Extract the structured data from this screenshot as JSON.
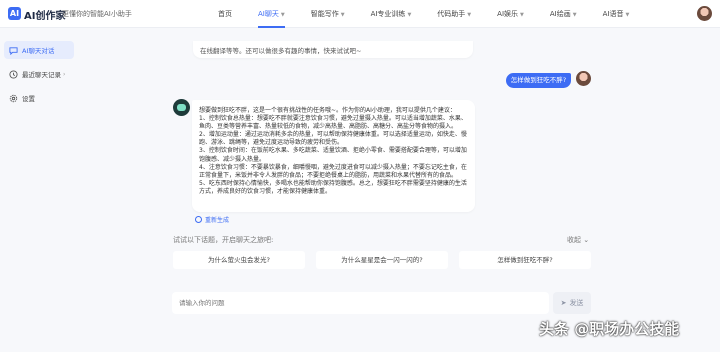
{
  "header": {
    "logo_icon": "AI",
    "logo_text": "AI创作家",
    "slogan": "更懂你的智能AI小助手",
    "nav": [
      {
        "label": "首页",
        "has_chevron": false,
        "active": false
      },
      {
        "label": "AI聊天",
        "has_chevron": true,
        "active": true
      },
      {
        "label": "智能写作",
        "has_chevron": true,
        "active": false
      },
      {
        "label": "AI专业训练",
        "has_chevron": true,
        "active": false
      },
      {
        "label": "代码助手",
        "has_chevron": true,
        "active": false
      },
      {
        "label": "AI娱乐",
        "has_chevron": true,
        "active": false
      },
      {
        "label": "AI绘画",
        "has_chevron": true,
        "active": false
      },
      {
        "label": "AI语音",
        "has_chevron": true,
        "active": false
      }
    ]
  },
  "sidebar": {
    "items": [
      {
        "label": "AI聊天对话",
        "icon": "chat-bubble-icon",
        "active": true
      },
      {
        "label": "最近聊天记录",
        "icon": "clock-icon",
        "active": false,
        "chevron": "›"
      },
      {
        "label": "设置",
        "icon": "gear-icon",
        "active": false
      }
    ]
  },
  "chat": {
    "top_bubble": "在线翻译等等。还可以做很多有趣的事情，快来试试吧~",
    "user_message": "怎样做到狂吃不胖?",
    "bot_reply": [
      "想要做到狂吃不胖，这是一个很有挑战性的任务哦~。作为你的AI小助理，我可以提供几个建议：",
      "1、控制饮食总热量：想要吃不胖就要注意饮食习惯，避免过量摄入热量。可以适当增加蔬菜、水果、鱼肉、豆类等营养丰富、热量较低的食物，减少高热量、高脂肪、高糖分、高盐分等食物的摄入。",
      "2、增加运动量：通过运动消耗多余的热量，可以帮助保持健康体重。可以选择适量运动，如快走、慢跑、游泳、跳绳等，避免过度运动导致的疲劳和受伤。",
      "3、控制饮食时间：在饭前吃水果、多吃蔬菜、适量饮酒、拒绝小零食、需要搭配要合理等，可以增加饱腹感、减少摄入热量。",
      "4、注意饮食习惯：不要暴饮暴食，细嚼慢咽，避免过度进食可以减少摄入热量；不要忘记吃主食，在正常食量下，米饭并非令人发胖的食品；不要拒绝餐桌上的脂肪，用蔬菜和水果代替所有的食品。",
      "5、吃东西时保持心情愉快，多喝水也能帮助你保持饱腹感。总之，想要狂吃不胖需要坚持健康的生活方式，养成良好的饮食习惯，才能保持健康体重。"
    ],
    "regenerate_label": "重新生成",
    "suggest_title": "试试以下话题，开启聊天之旅吧:",
    "collapse_label": "收起",
    "suggestions": [
      "为什么萤火虫会发光?",
      "为什么星星是会一闪一闪的?",
      "怎样做到狂吃不胖?"
    ]
  },
  "input": {
    "placeholder": "请输入你的问题",
    "send_label": "发送"
  },
  "watermark": "头条 @职场办公技能",
  "colors": {
    "accent": "#3d6cf4",
    "background": "#f7f8fb"
  }
}
